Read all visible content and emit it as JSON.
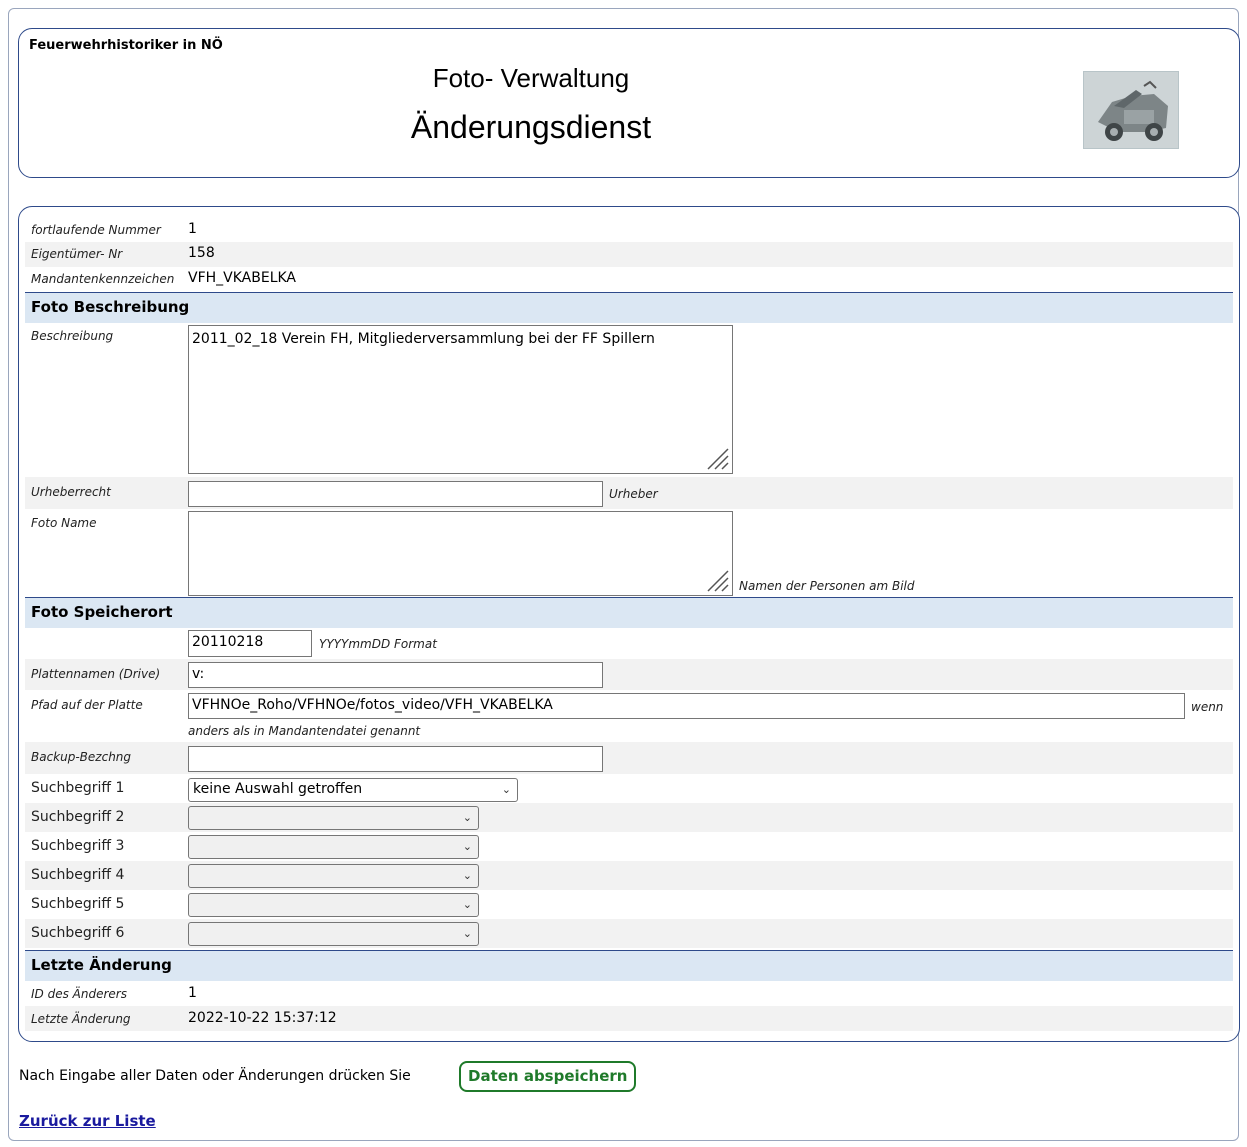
{
  "header": {
    "org_name": "Feuerwehrhistoriker in NÖ",
    "title": "Foto- Verwaltung",
    "subtitle": "Änderungsdienst"
  },
  "meta": {
    "running_number_label": "fortlaufende Nummer",
    "running_number": "1",
    "owner_no_label": "Eigentümer- Nr",
    "owner_no": "158",
    "tenant_label": "Mandantenkennzeichen",
    "tenant": "VFH_VKABELKA"
  },
  "section_description": {
    "title": "Foto Beschreibung",
    "description_label": "Beschreibung",
    "description_value": "2011_02_18 Verein FH, Mitgliederversammlung bei der FF Spillern",
    "copyright_label": "Urheberrecht",
    "copyright_value": "",
    "copyright_hint": "Urheber",
    "photo_name_label": "Foto Name",
    "photo_name_value": "",
    "photo_name_hint": "Namen der Personen am Bild"
  },
  "section_location": {
    "title": "Foto Speicherort",
    "date_value": "20110218",
    "date_hint": "YYYYmmDD Format",
    "drive_label": "Plattennamen (Drive)",
    "drive_value": "v:",
    "path_label": "Pfad auf der Platte",
    "path_value": "VFHNOe_Roho/VFHNOe/fotos_video/VFH_VKABELKA",
    "path_hint_suffix": "wenn",
    "path_hint": "anders als in Mandantendatei genannt",
    "backup_label": "Backup-Bezchng",
    "backup_value": "",
    "search_terms": [
      {
        "label": "Suchbegriff 1",
        "value": "keine Auswahl getroffen"
      },
      {
        "label": "Suchbegriff 2",
        "value": ""
      },
      {
        "label": "Suchbegriff 3",
        "value": ""
      },
      {
        "label": "Suchbegriff 4",
        "value": ""
      },
      {
        "label": "Suchbegriff 5",
        "value": ""
      },
      {
        "label": "Suchbegriff 6",
        "value": ""
      }
    ]
  },
  "section_last_change": {
    "title": "Letzte Änderung",
    "changer_id_label": "ID des Änderers",
    "changer_id": "1",
    "last_change_label": "Letzte Änderung",
    "last_change": "2022-10-22 15:37:12"
  },
  "footer": {
    "instruction": "Nach Eingabe aller Daten oder Änderungen drücken Sie",
    "save_label": "Daten abspeichern",
    "back_link": "Zurück zur Liste"
  },
  "colors": {
    "border_blue": "#2e4a8a",
    "section_bg": "#dbe7f3",
    "button_green": "#1f7a2a",
    "link_blue": "#1a1a9e"
  }
}
